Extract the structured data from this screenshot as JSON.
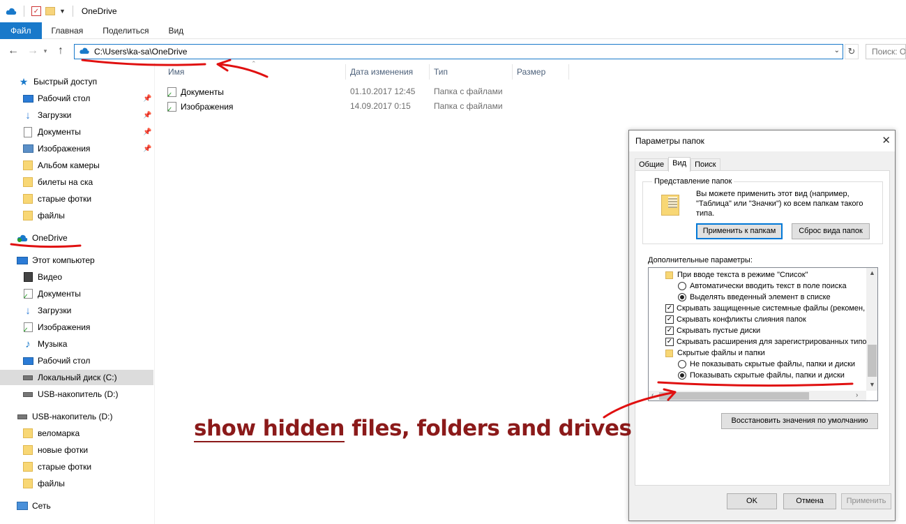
{
  "window": {
    "title": "OneDrive"
  },
  "ribbon": {
    "tabs": [
      {
        "label": "Файл"
      },
      {
        "label": "Главная"
      },
      {
        "label": "Поделиться"
      },
      {
        "label": "Вид"
      }
    ]
  },
  "address": {
    "path": "C:\\Users\\ka-sa\\OneDrive",
    "search_placeholder": "Поиск: On"
  },
  "nav": {
    "quick_access": "Быстрый доступ",
    "quick_items": [
      "Рабочий стол",
      "Загрузки",
      "Документы",
      "Изображения",
      "Альбом камеры",
      "билеты на ска",
      "старые фотки",
      "файлы"
    ],
    "onedrive": "OneDrive",
    "this_pc": "Этот компьютер",
    "pc_items": [
      "Видео",
      "Документы",
      "Загрузки",
      "Изображения",
      "Музыка",
      "Рабочий стол",
      "Локальный диск (C:)",
      "USB-накопитель (D:)"
    ],
    "usb": "USB-накопитель (D:)",
    "usb_items": [
      "веломарка",
      "новые фотки",
      "старые фотки",
      "файлы"
    ],
    "network": "Сеть"
  },
  "files": {
    "columns": {
      "name": "Имя",
      "date": "Дата изменения",
      "type": "Тип",
      "size": "Размер"
    },
    "rows": [
      {
        "name": "Документы",
        "date": "01.10.2017 12:45",
        "type": "Папка с файлами"
      },
      {
        "name": "Изображения",
        "date": "14.09.2017 0:15",
        "type": "Папка с файлами"
      }
    ]
  },
  "dialog": {
    "title": "Параметры папок",
    "tabs": [
      "Общие",
      "Вид",
      "Поиск"
    ],
    "group_label": "Представление папок",
    "group_text": "Вы можете применить этот вид (например, \"Таблица\" или \"Значки\") ко всем папкам такого типа.",
    "apply_button": "Применить к папкам",
    "reset_button": "Сброс вида папок",
    "advanced_label": "Дополнительные параметры:",
    "tree": [
      "При вводе текста в режиме \"Список\"",
      "Автоматически вводить текст в поле поиска",
      "Выделять введенный элемент в списке",
      "Скрывать защищенные системные файлы (рекомен,",
      "Скрывать конфликты слияния папок",
      "Скрывать пустые диски",
      "Скрывать расширения для зарегистрированных типо",
      "Скрытые файлы и папки",
      "Не показывать скрытые файлы, папки и диски",
      "Показывать скрытые файлы, папки и диски"
    ],
    "restore_button": "Восстановить значения по умолчанию",
    "ok_button": "OK",
    "cancel_button": "Отмена",
    "apply_button_footer": "Применить"
  },
  "annotation": {
    "text": "show hidden files, folders and drives",
    "color": "#8b1a1a"
  },
  "colors": {
    "accent": "#1979ca",
    "annotation_red": "#e01010"
  }
}
